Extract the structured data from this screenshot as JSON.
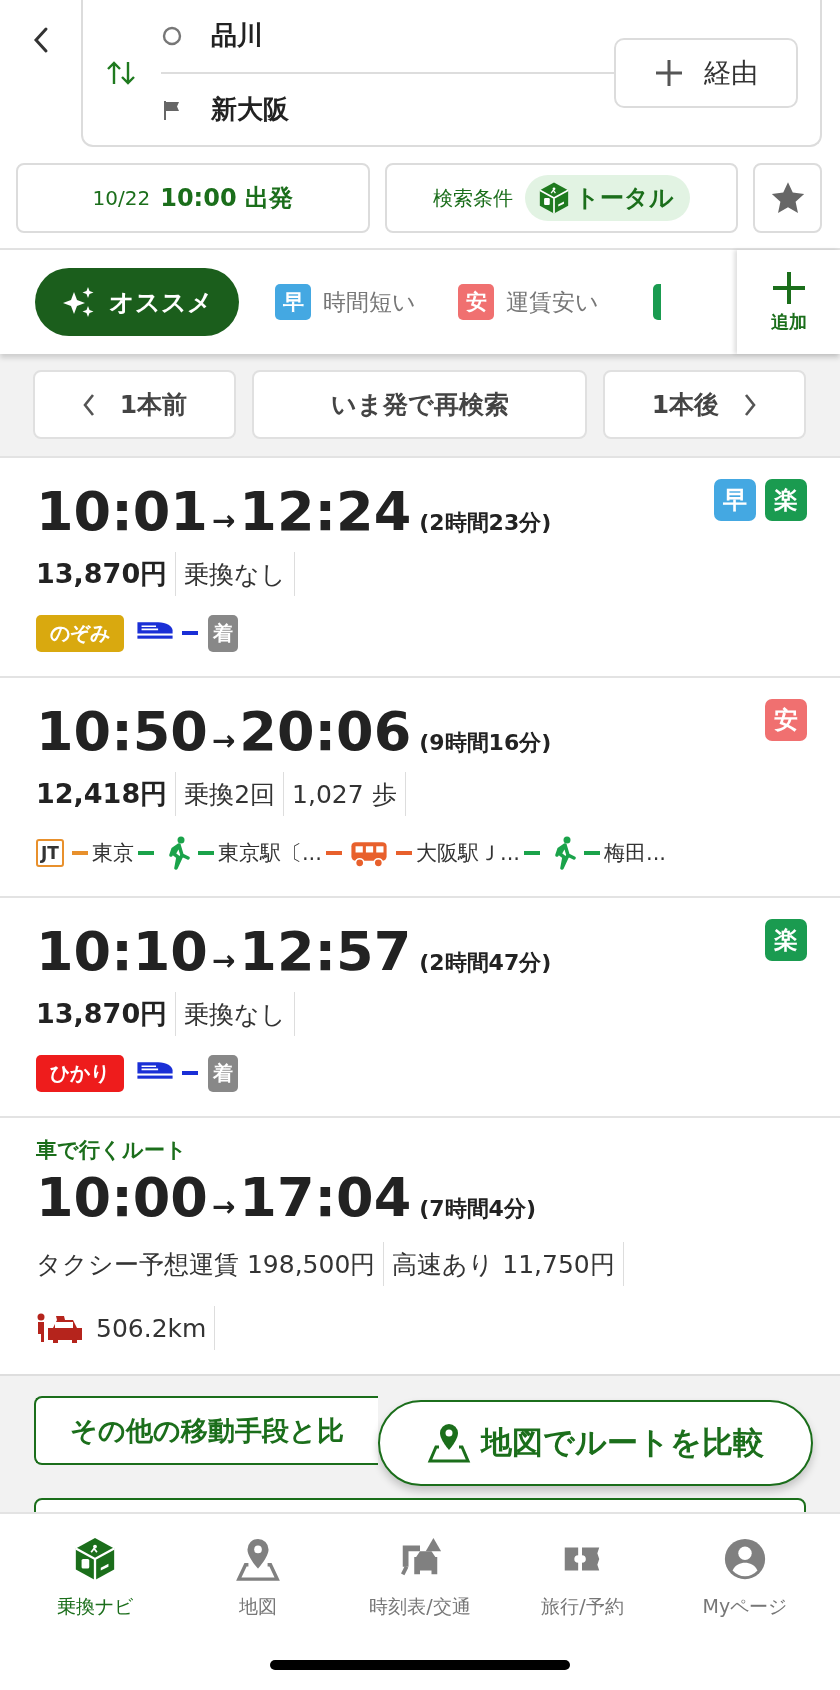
{
  "header": {
    "origin": "品川",
    "destination": "新大阪",
    "via_button": "経由"
  },
  "conditions": {
    "date": "10/22",
    "time": "10:00 出発",
    "condition_label": "検索条件",
    "condition_value": "トータル"
  },
  "sort_tabs": [
    {
      "label": "オススメ",
      "selected": true
    },
    {
      "label": "時間短い",
      "badge": "早",
      "color": "#44a8e2",
      "selected": false
    },
    {
      "label": "運賃安い",
      "badge": "安",
      "color": "#f07070",
      "selected": false
    },
    {
      "color": "#1a9b50",
      "selected": false
    }
  ],
  "add_button": "追加",
  "paging": {
    "prev": "1本前",
    "now": "いま発で再検索",
    "next": "1本後"
  },
  "routes": [
    {
      "depart": "10:01",
      "arrow": "→",
      "arrive": "12:24",
      "duration": "(2時間23分)",
      "tags": [
        {
          "text": "早",
          "color": "#44a8e2"
        },
        {
          "text": "楽",
          "color": "#1a9b50"
        }
      ],
      "stats": [
        "13,870円",
        "乗換なし"
      ],
      "legs": [
        {
          "kind": "badge",
          "text": "のぞみ",
          "color": "#d9a90f"
        },
        {
          "kind": "shinkansen",
          "color": "#1a2fd6"
        },
        {
          "kind": "line",
          "color": "#1a2fd6"
        },
        {
          "kind": "arrival",
          "text": "着"
        }
      ]
    },
    {
      "depart": "10:50",
      "arrow": "→",
      "arrive": "20:06",
      "duration": "(9時間16分)",
      "tags": [
        {
          "text": "安",
          "color": "#f07070"
        }
      ],
      "stats": [
        "12,418円",
        "乗換2回",
        "1,027 歩"
      ],
      "legs": [
        {
          "kind": "box",
          "text": "JT",
          "color": "#e8902c"
        },
        {
          "kind": "line",
          "color": "#e8902c"
        },
        {
          "kind": "station",
          "text": "東京"
        },
        {
          "kind": "line",
          "color": "#1aa34a"
        },
        {
          "kind": "walk",
          "color": "#1aa34a"
        },
        {
          "kind": "line",
          "color": "#1aa34a"
        },
        {
          "kind": "station",
          "text": "東京駅〔..."
        },
        {
          "kind": "line",
          "color": "#e8602c"
        },
        {
          "kind": "bus",
          "color": "#e8602c"
        },
        {
          "kind": "line",
          "color": "#e8602c"
        },
        {
          "kind": "station",
          "text": "大阪駅Ｊ..."
        },
        {
          "kind": "line",
          "color": "#1aa34a"
        },
        {
          "kind": "walk",
          "color": "#1aa34a"
        },
        {
          "kind": "line",
          "color": "#1aa34a"
        },
        {
          "kind": "station",
          "text": "梅田..."
        }
      ]
    },
    {
      "depart": "10:10",
      "arrow": "→",
      "arrive": "12:57",
      "duration": "(2時間47分)",
      "tags": [
        {
          "text": "楽",
          "color": "#1a9b50"
        }
      ],
      "stats": [
        "13,870円",
        "乗換なし"
      ],
      "legs": [
        {
          "kind": "badge",
          "text": "ひかり",
          "color": "#ee1c1c"
        },
        {
          "kind": "shinkansen",
          "color": "#1a2fd6"
        },
        {
          "kind": "line",
          "color": "#1a2fd6"
        },
        {
          "kind": "arrival",
          "text": "着"
        }
      ]
    }
  ],
  "car_route": {
    "label": "車で行くルート",
    "depart": "10:00",
    "arrow": "→",
    "arrive": "17:04",
    "duration": "(7時間4分)",
    "stats": [
      "タクシー予想運賃 198,500円",
      "高速あり 11,750円"
    ],
    "distance": "506.2km"
  },
  "compare_button": "その他の移動手段と比",
  "map_compare_button": "地図でルートを比較",
  "nav": [
    {
      "kind": "cube",
      "label": "乗換ナビ",
      "selected": true
    },
    {
      "kind": "map",
      "label": "地図",
      "selected": false
    },
    {
      "kind": "traffic",
      "label": "時刻表/交通",
      "selected": false
    },
    {
      "kind": "ticket",
      "label": "旅行/予約",
      "selected": false
    },
    {
      "kind": "user",
      "label": "Myページ",
      "selected": false
    }
  ]
}
